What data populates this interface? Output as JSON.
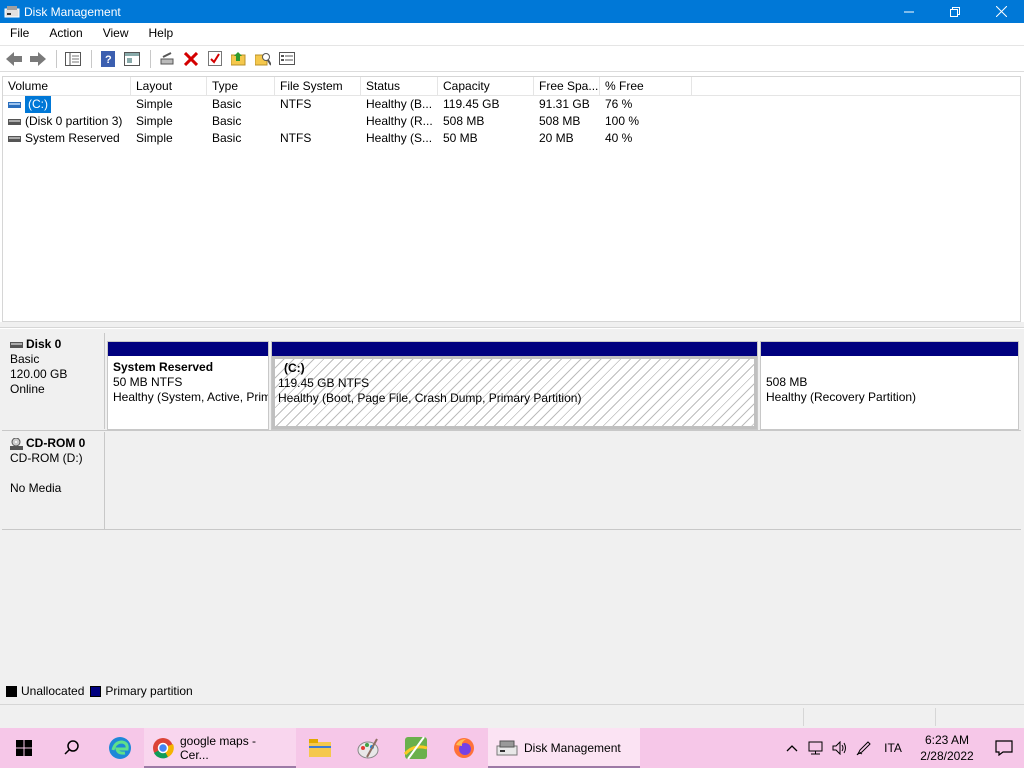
{
  "window": {
    "title": "Disk Management",
    "accent": "#0078d7"
  },
  "menu": [
    "File",
    "Action",
    "View",
    "Help"
  ],
  "volume_list": {
    "columns": [
      "Volume",
      "Layout",
      "Type",
      "File System",
      "Status",
      "Capacity",
      "Free Spa...",
      "% Free"
    ],
    "rows": [
      {
        "volume": "(C:)",
        "layout": "Simple",
        "type": "Basic",
        "fs": "NTFS",
        "status": "Healthy (B...",
        "capacity": "119.45 GB",
        "free": "91.31 GB",
        "pct": "76 %"
      },
      {
        "volume": "(Disk 0 partition 3)",
        "layout": "Simple",
        "type": "Basic",
        "fs": "",
        "status": "Healthy (R...",
        "capacity": "508 MB",
        "free": "508 MB",
        "pct": "100 %"
      },
      {
        "volume": "System Reserved",
        "layout": "Simple",
        "type": "Basic",
        "fs": "NTFS",
        "status": "Healthy (S...",
        "capacity": "50 MB",
        "free": "20 MB",
        "pct": "40 %"
      }
    ]
  },
  "disks": [
    {
      "name": "Disk 0",
      "kind": "Basic",
      "size": "120.00 GB",
      "state": "Online",
      "partitions": [
        {
          "name": "System Reserved",
          "size": "50 MB NTFS",
          "status": "Healthy (System, Active, Primary Partition)"
        },
        {
          "name": "(C:)",
          "size": "119.45 GB NTFS",
          "status": "Healthy (Boot, Page File, Crash Dump, Primary Partition)"
        },
        {
          "name": "",
          "size": "508 MB",
          "status": "Healthy (Recovery Partition)"
        }
      ]
    },
    {
      "name": "CD-ROM 0",
      "kind": "CD-ROM (D:)",
      "state": "No Media"
    }
  ],
  "legend": [
    {
      "label": "Unallocated",
      "color": "#000000"
    },
    {
      "label": "Primary partition",
      "color": "#00007f"
    }
  ],
  "taskbar": {
    "chrome_label": "google maps - Cer...",
    "active_label": "Disk Management",
    "language": "ITA",
    "time": "6:23 AM",
    "date": "2/28/2022",
    "color": "#f6c7e8"
  }
}
